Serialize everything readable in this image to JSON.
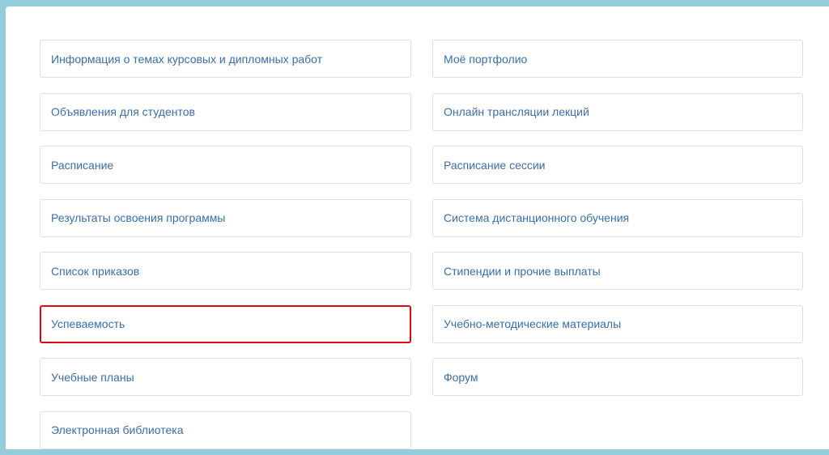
{
  "links": {
    "left": [
      "Информация о темах курсовых и дипломных работ",
      "Объявления для студентов",
      "Расписание",
      "Результаты освоения программы",
      "Список приказов",
      "Успеваемость",
      "Учебные планы",
      "Электронная библиотека"
    ],
    "right": [
      "Моё портфолио",
      "Онлайн трансляции лекций",
      "Расписание сессии",
      "Система дистанционного обучения",
      "Стипендии и прочие выплаты",
      "Учебно-методические материалы",
      "Форум"
    ]
  },
  "colors": {
    "frame": "#95ccdb",
    "link_text": "#3a6ea5",
    "card_border": "#dcdfe3",
    "highlight": "#e30613"
  }
}
